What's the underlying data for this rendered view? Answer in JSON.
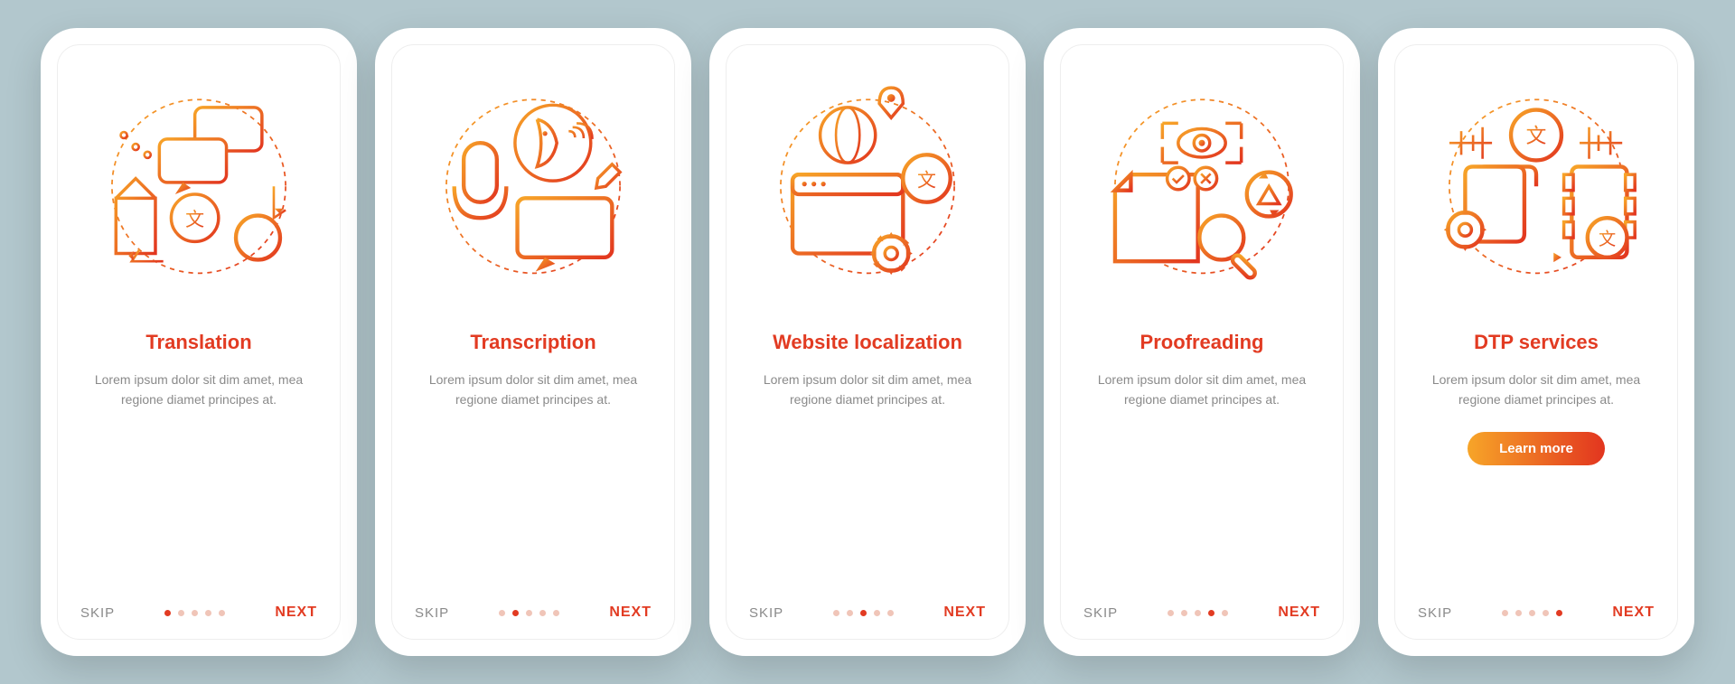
{
  "common": {
    "skip": "SKIP",
    "next": "NEXT",
    "lorem": "Lorem ipsum dolor sit dim amet, mea regione diamet principes at."
  },
  "screens": [
    {
      "title": "Translation",
      "hasCta": false,
      "active": 0
    },
    {
      "title": "Transcription",
      "hasCta": false,
      "active": 1
    },
    {
      "title": "Website localization",
      "hasCta": false,
      "active": 2
    },
    {
      "title": "Proofreading",
      "hasCta": false,
      "active": 3
    },
    {
      "title": "DTP services",
      "hasCta": true,
      "cta": "Learn more",
      "active": 4
    }
  ]
}
